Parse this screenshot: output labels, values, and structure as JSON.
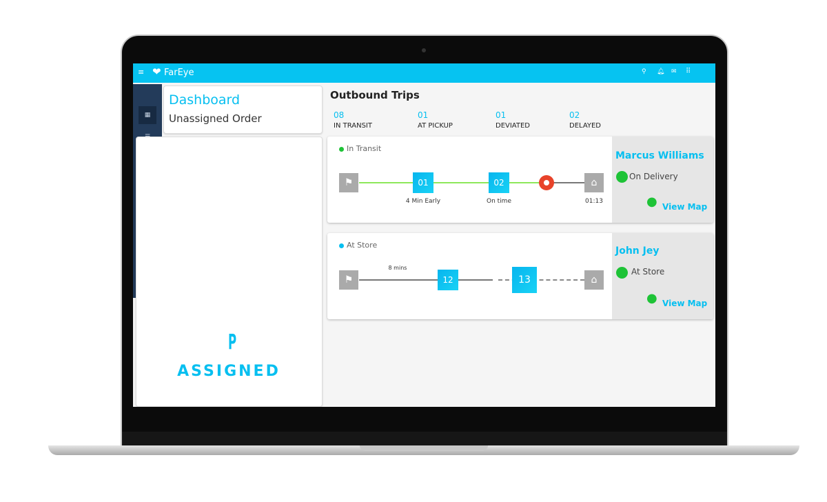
{
  "app": {
    "brand": "FarEye"
  },
  "topbar": {
    "icons": [
      "search-icon",
      "bell-icon",
      "mail-icon",
      "apps-grid-icon"
    ]
  },
  "sidebar": {
    "items": [
      "dashboard-icon",
      "list-icon",
      "users-icon",
      "vehicle-icon",
      "shop-icon",
      "document-icon",
      "analytics-icon"
    ]
  },
  "left_panel": {
    "title": "Dashboard",
    "subtitle": "Unassigned Order",
    "logo_text": "ASSIGNED"
  },
  "outbound": {
    "title": "Outbound Trips",
    "stats": [
      {
        "value": "08",
        "label": "IN TRANSIT"
      },
      {
        "value": "01",
        "label": "AT PICKUP"
      },
      {
        "value": "01",
        "label": "DEVIATED"
      },
      {
        "value": "02",
        "label": "DELAYED"
      }
    ]
  },
  "trips": [
    {
      "status": "In Transit",
      "status_color": "#1ec337",
      "stops": [
        {
          "id": "01",
          "note": "4 Min Early"
        },
        {
          "id": "02",
          "note": "On time"
        }
      ],
      "end_time": "01:13",
      "driver": "Marcus Williams",
      "driver_status": "On Delivery",
      "view_map": "View Map"
    },
    {
      "status": "At Store",
      "status_color": "#06bff0",
      "segment_note": "8 mins",
      "stops": [
        {
          "id": "12"
        },
        {
          "id": "13"
        }
      ],
      "driver": "John Jey",
      "driver_status": "At Store",
      "view_map": "View Map"
    }
  ],
  "colors": {
    "accent": "#06c3f1",
    "sidebar": "#233b5a",
    "progress": "#8de85a",
    "alert": "#e8432a",
    "green": "#1ec337"
  }
}
